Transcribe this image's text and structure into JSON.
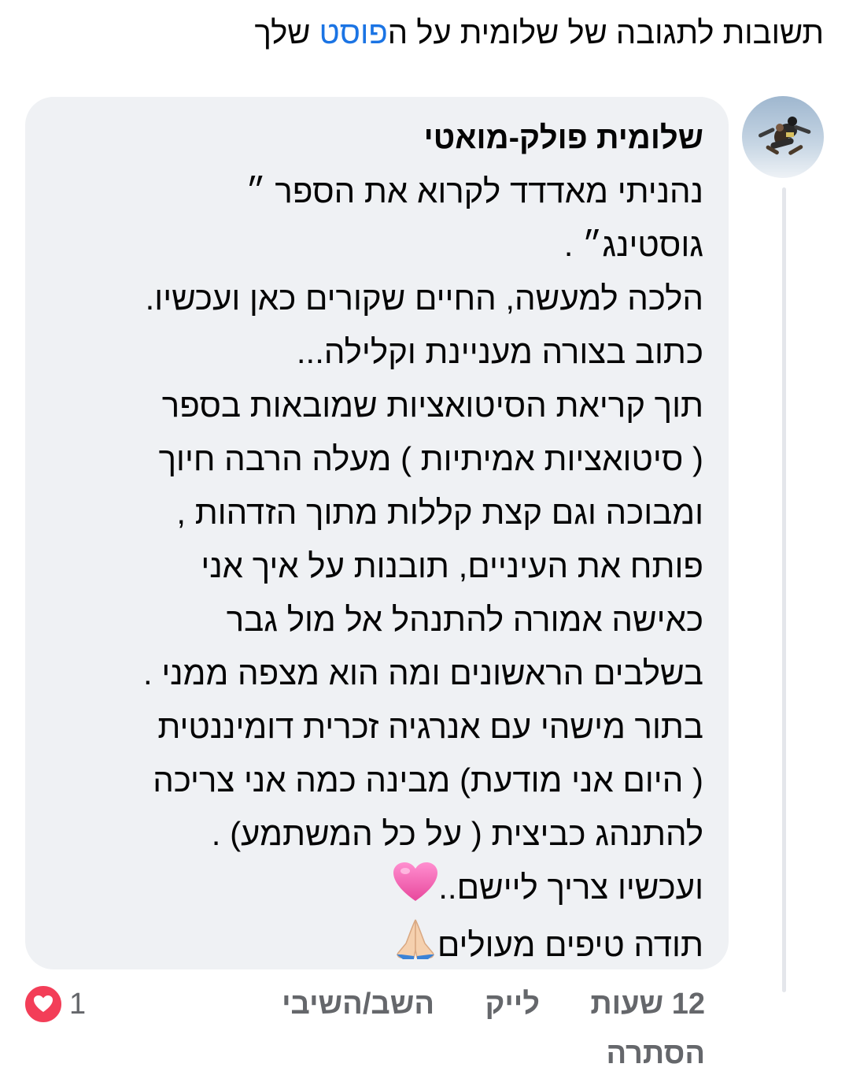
{
  "header": {
    "title_prefix": "תשובות לתגובה של שלומית על ה",
    "title_link": "פוסט",
    "title_suffix": " שלך"
  },
  "comment": {
    "author": "שלומית פולק-מואטי",
    "lines": [
      "נהניתי מאדדד לקרוא את הספר ״",
      "גוסטינג״ .",
      "הלכה למעשה,  החיים שקורים כאן ועכשיו.",
      "כתוב בצורה מעניינת וקלילה...",
      "תוך קריאת הסיטואציות שמובאות בספר",
      "( סיטואציות אמיתיות ) מעלה הרבה חיוך",
      "ומבוכה וגם קצת קללות מתוך הזדהות ,",
      "פותח את העיניים, תובנות על איך אני",
      "כאישה אמורה להתנהל אל מול גבר",
      "בשלבים הראשונים ומה הוא מצפה ממני .",
      "בתור מישהי עם אנרגיה זכרית דומיננטית",
      "( היום אני מודעת) מבינה כמה אני צריכה",
      "להתנהג כביצית ( על כל המשתמע) .",
      "ועכשיו צריך ליישם..",
      "תודה טיפים מעולים"
    ],
    "line14_emoji": "pink-heart-icon",
    "line15_emoji": "folded-hands-icon"
  },
  "actions": {
    "time": "12 שעות",
    "like": "לייק",
    "reply": "השב/השיבי",
    "hide": "הסתרה"
  },
  "reactions": {
    "count": "1",
    "icon": "heart-reaction-icon",
    "color": "#f33e58"
  },
  "colors": {
    "link": "#1b74e4",
    "bubble": "#eff1f4",
    "meta": "#65676b"
  }
}
